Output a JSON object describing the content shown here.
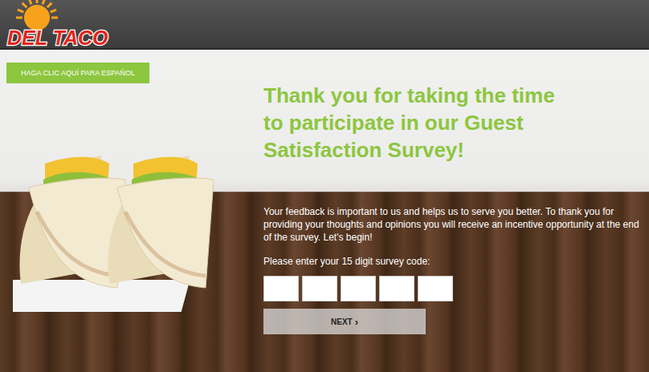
{
  "header": {
    "logo": "DEL TACO"
  },
  "language_button": {
    "label": "HAGA CLIC AQUÍ PARA ESPAÑOL"
  },
  "heading": "Thank you for taking the time to participate in our Guest Satisfaction Survey!",
  "intro": "Your feedback is important to us and helps us to serve you better. To thank you for providing your thoughts and opinions you will receive an incentive opportunity at the end of the survey. Let's begin!",
  "survey_code": {
    "label": "Please enter your 15 digit survey code:",
    "fields": [
      {
        "value": ""
      },
      {
        "value": ""
      },
      {
        "value": ""
      },
      {
        "value": ""
      },
      {
        "value": ""
      }
    ]
  },
  "next_button": {
    "label": "NEXT",
    "icon": "›"
  }
}
